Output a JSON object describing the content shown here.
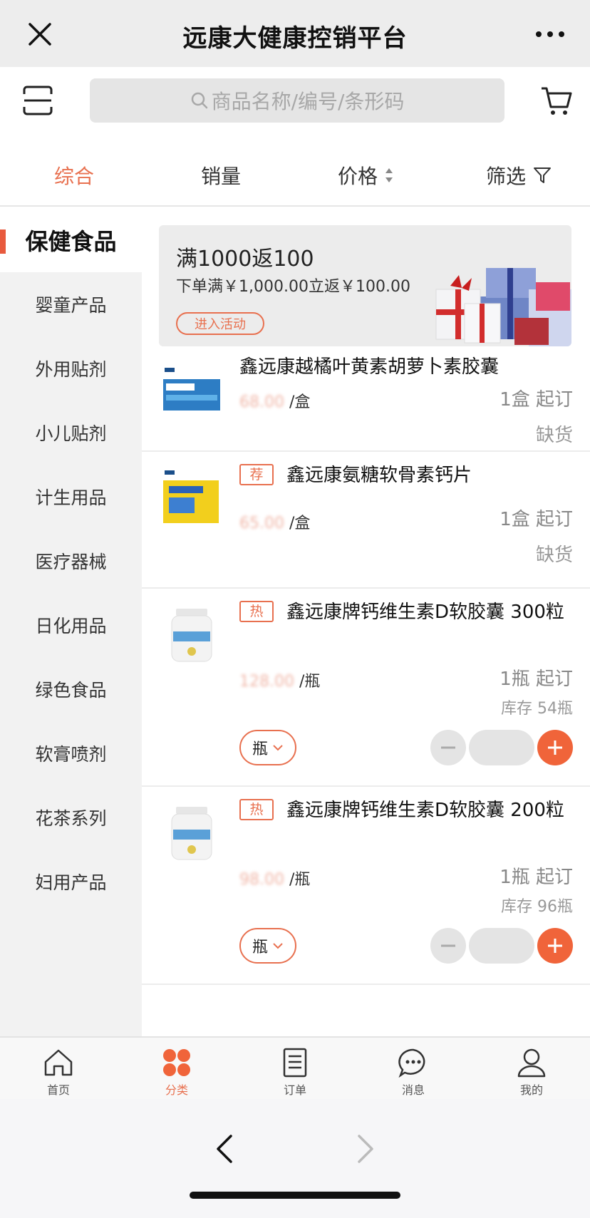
{
  "titlebar": {
    "title": "远康大健康控销平台"
  },
  "search": {
    "placeholder": "商品名称/编号/条形码"
  },
  "sort": {
    "tabs": [
      {
        "label": "综合",
        "active": true
      },
      {
        "label": "销量"
      },
      {
        "label": "价格"
      },
      {
        "label": "筛选"
      }
    ]
  },
  "sidebar": {
    "items": [
      {
        "label": "保健食品",
        "active": true
      },
      {
        "label": "婴童产品"
      },
      {
        "label": "外用贴剂"
      },
      {
        "label": "小儿贴剂"
      },
      {
        "label": "计生用品"
      },
      {
        "label": "医疗器械"
      },
      {
        "label": "日化用品"
      },
      {
        "label": "绿色食品"
      },
      {
        "label": "软膏喷剂"
      },
      {
        "label": "花茶系列"
      },
      {
        "label": "妇用产品"
      }
    ]
  },
  "banner": {
    "title": "满1000返100",
    "desc": "下单满￥1,000.00立返￥100.00",
    "button": "进入活动"
  },
  "products": [
    {
      "name": "鑫远康越橘叶黄素胡萝卜素胶囊",
      "tag": "",
      "price": "68.00",
      "unit": "/盒",
      "min_order": "1盒 起订",
      "status": "缺货"
    },
    {
      "name": "鑫远康氨糖软骨素钙片",
      "tag": "荐",
      "price": "65.00",
      "unit": "/盒",
      "min_order": "1盒 起订",
      "status": "缺货"
    },
    {
      "name": "鑫远康牌钙维生素D软胶囊 300粒",
      "tag": "热",
      "price": "128.00",
      "unit": "/瓶",
      "min_order": "1瓶 起订",
      "stock": "库存 54瓶",
      "unit_select": "瓶"
    },
    {
      "name": "鑫远康牌钙维生素D软胶囊 200粒",
      "tag": "热",
      "price": "98.00",
      "unit": "/瓶",
      "min_order": "1瓶 起订",
      "stock": "库存 96瓶",
      "unit_select": "瓶"
    }
  ],
  "tabbar": {
    "items": [
      {
        "label": "首页"
      },
      {
        "label": "分类",
        "active": true
      },
      {
        "label": "订单"
      },
      {
        "label": "消息"
      },
      {
        "label": "我的"
      }
    ]
  },
  "colors": {
    "accent": "#e8704f",
    "plus_button": "#f0643a",
    "sidebar_bg": "#f2f2f2"
  }
}
